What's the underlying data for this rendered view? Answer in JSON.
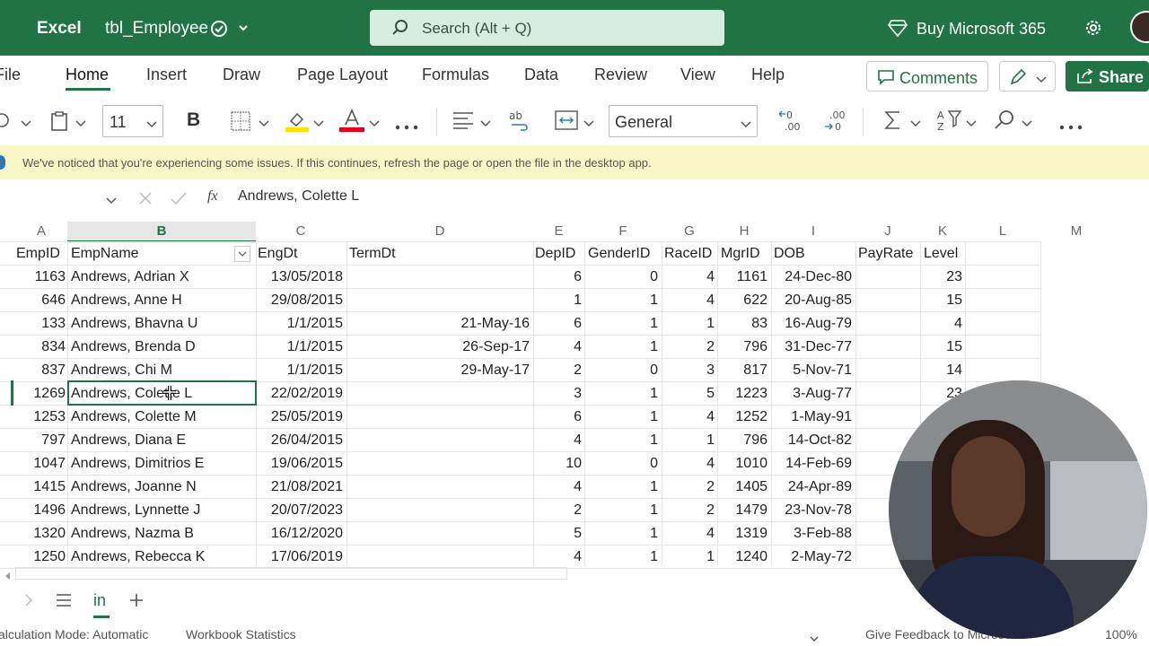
{
  "title_bar": {
    "app": "Excel",
    "file": "tbl_Employee",
    "search_placeholder": "Search (Alt + Q)",
    "buy": "Buy Microsoft 365"
  },
  "menu": {
    "tabs": [
      "File",
      "Home",
      "Insert",
      "Draw",
      "Page Layout",
      "Formulas",
      "Data",
      "Review",
      "View",
      "Help"
    ],
    "comments": "Comments",
    "share": "Share"
  },
  "toolbar": {
    "font_size": "11",
    "bold": "B",
    "number_format": "General"
  },
  "notice": "We've noticed that you're experiencing some issues. If this continues, refresh the page or open the file in the desktop app.",
  "formula_bar": {
    "fx": "fx",
    "value": "Andrews, Colette L"
  },
  "columns": [
    "A",
    "B",
    "C",
    "D",
    "E",
    "F",
    "G",
    "H",
    "I",
    "J",
    "K",
    "L",
    "M"
  ],
  "headers": {
    "EmpID": "EmpID",
    "EmpName": "EmpName",
    "EngDt": "EngDt",
    "TermDt": "TermDt",
    "DepID": "DepID",
    "GenderID": "GenderID",
    "RaceID": "RaceID",
    "MgrID": "MgrID",
    "DOB": "DOB",
    "PayRate": "PayRate",
    "Level": "Level"
  },
  "rows": [
    {
      "id": "1163",
      "name": "Andrews, Adrian X",
      "eng": "13/05/2018",
      "term": "",
      "dep": "6",
      "gender": "0",
      "race": "4",
      "mgr": "1161",
      "dob": "24-Dec-80",
      "level": "23"
    },
    {
      "id": "646",
      "name": "Andrews, Anne H",
      "eng": "29/08/2015",
      "term": "",
      "dep": "1",
      "gender": "1",
      "race": "4",
      "mgr": "622",
      "dob": "20-Aug-85",
      "level": "15"
    },
    {
      "id": "133",
      "name": "Andrews, Bhavna U",
      "eng": "1/1/2015",
      "term": "21-May-16",
      "dep": "6",
      "gender": "1",
      "race": "1",
      "mgr": "83",
      "dob": "16-Aug-79",
      "level": "4"
    },
    {
      "id": "834",
      "name": "Andrews, Brenda D",
      "eng": "1/1/2015",
      "term": "26-Sep-17",
      "dep": "4",
      "gender": "1",
      "race": "2",
      "mgr": "796",
      "dob": "31-Dec-77",
      "level": "15"
    },
    {
      "id": "837",
      "name": "Andrews, Chi M",
      "eng": "1/1/2015",
      "term": "29-May-17",
      "dep": "2",
      "gender": "0",
      "race": "3",
      "mgr": "817",
      "dob": "5-Nov-71",
      "level": "14"
    },
    {
      "id": "1269",
      "name": "Andrews, Colette L",
      "eng": "22/02/2019",
      "term": "",
      "dep": "3",
      "gender": "1",
      "race": "5",
      "mgr": "1223",
      "dob": "3-Aug-77",
      "level": "23"
    },
    {
      "id": "1253",
      "name": "Andrews, Colette M",
      "eng": "25/05/2019",
      "term": "",
      "dep": "6",
      "gender": "1",
      "race": "4",
      "mgr": "1252",
      "dob": "1-May-91",
      "level": ""
    },
    {
      "id": "797",
      "name": "Andrews, Diana E",
      "eng": "26/04/2015",
      "term": "",
      "dep": "4",
      "gender": "1",
      "race": "1",
      "mgr": "796",
      "dob": "14-Oct-82",
      "level": ""
    },
    {
      "id": "1047",
      "name": "Andrews, Dimitrios E",
      "eng": "19/06/2015",
      "term": "",
      "dep": "10",
      "gender": "0",
      "race": "4",
      "mgr": "1010",
      "dob": "14-Feb-69",
      "level": ""
    },
    {
      "id": "1415",
      "name": "Andrews, Joanne N",
      "eng": "21/08/2021",
      "term": "",
      "dep": "4",
      "gender": "1",
      "race": "2",
      "mgr": "1405",
      "dob": "24-Apr-89",
      "level": ""
    },
    {
      "id": "1496",
      "name": "Andrews, Lynnette J",
      "eng": "20/07/2023",
      "term": "",
      "dep": "2",
      "gender": "1",
      "race": "2",
      "mgr": "1479",
      "dob": "23-Nov-78",
      "level": ""
    },
    {
      "id": "1320",
      "name": "Andrews, Nazma B",
      "eng": "16/12/2020",
      "term": "",
      "dep": "5",
      "gender": "1",
      "race": "4",
      "mgr": "1319",
      "dob": "3-Feb-88",
      "level": ""
    },
    {
      "id": "1250",
      "name": "Andrews, Rebecca K",
      "eng": "17/06/2019",
      "term": "",
      "dep": "4",
      "gender": "1",
      "race": "1",
      "mgr": "1240",
      "dob": "2-May-72",
      "level": ""
    }
  ],
  "sheet_tab": "in",
  "status": {
    "calc": "alculation Mode: Automatic",
    "stats": "Workbook Statistics",
    "feedback": "Give Feedback to Microsoft",
    "zoom": "100%"
  },
  "colors": {
    "brand": "#217346",
    "search": "#d6ede0",
    "notice": "#fbf6c8"
  }
}
